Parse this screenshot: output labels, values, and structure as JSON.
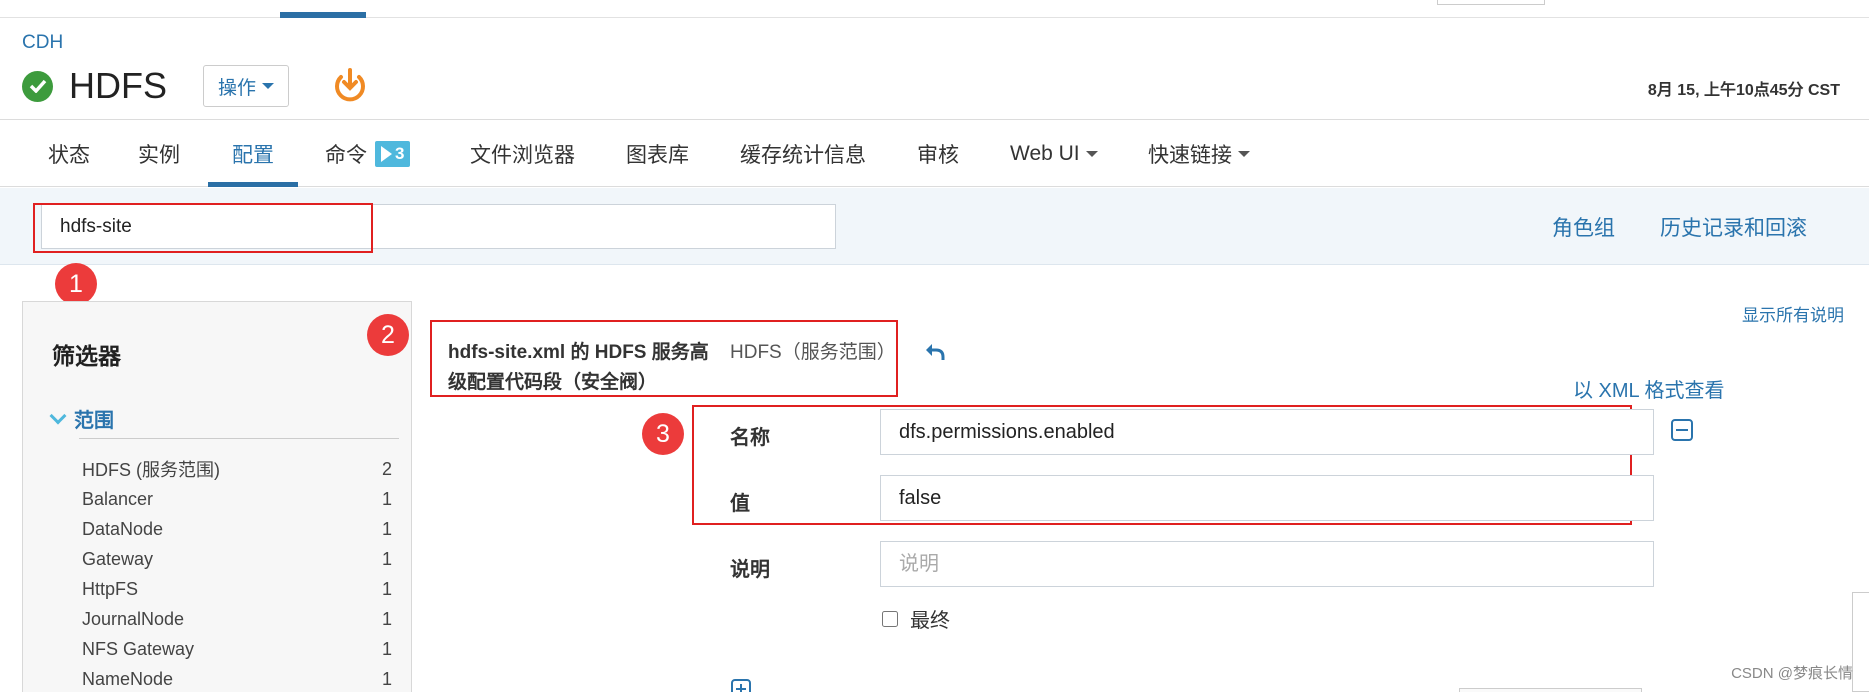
{
  "header": {
    "cluster": "CDH",
    "service": "HDFS",
    "actions_label": "操作",
    "timestamp": "8月 15, 上午10点45分 CST"
  },
  "tabs": [
    {
      "label": "状态"
    },
    {
      "label": "实例"
    },
    {
      "label": "配置",
      "active": true
    },
    {
      "label": "命令",
      "badge": "3"
    },
    {
      "label": "文件浏览器"
    },
    {
      "label": "图表库"
    },
    {
      "label": "缓存统计信息"
    },
    {
      "label": "审核"
    },
    {
      "label": "Web UI"
    },
    {
      "label": "快速链接"
    }
  ],
  "search": {
    "value": "hdfs-site"
  },
  "toolbar": {
    "role_groups": "角色组",
    "history": "历史记录和回滚"
  },
  "annotations": [
    "1",
    "2",
    "3"
  ],
  "sidebar": {
    "title": "筛选器",
    "scope_heading": "范围",
    "items": [
      {
        "label": "HDFS (服务范围)",
        "count": "2"
      },
      {
        "label": "Balancer",
        "count": "1"
      },
      {
        "label": "DataNode",
        "count": "1"
      },
      {
        "label": "Gateway",
        "count": "1"
      },
      {
        "label": "HttpFS",
        "count": "1"
      },
      {
        "label": "JournalNode",
        "count": "1"
      },
      {
        "label": "NFS Gateway",
        "count": "1"
      },
      {
        "label": "NameNode",
        "count": "1"
      }
    ]
  },
  "property": {
    "title": "hdfs-site.xml 的 HDFS 服务高级配置代码段（安全阀）",
    "scope": "HDFS（服务范围）",
    "show_all": "显示所有说明",
    "xml_view": "以 XML 格式查看",
    "name_label": "名称",
    "name_value": "dfs.permissions.enabled",
    "value_label": "值",
    "value_value": "false",
    "desc_label": "说明",
    "desc_placeholder": "说明",
    "final_label": "最终"
  },
  "watermark": "CSDN @梦痕长情",
  "colors": {
    "link": "#2a74ad",
    "accent": "#2b6fa5",
    "ok": "#3d9b3d",
    "power": "#f08a24",
    "annotation": "#e02020",
    "badge": "#4fb8dd"
  }
}
